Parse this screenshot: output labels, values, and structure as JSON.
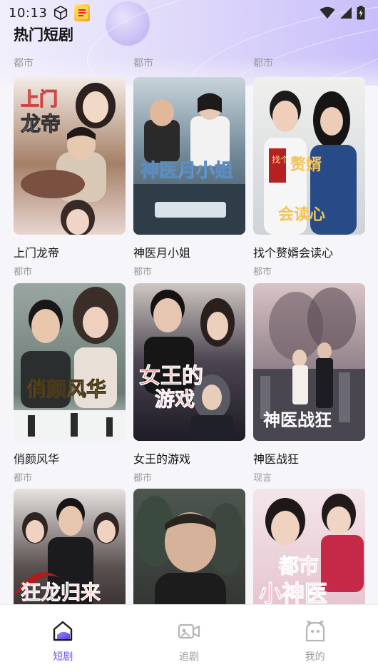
{
  "status": {
    "time": "10:13",
    "cube_icon": "cube-icon",
    "app_badge_text": "",
    "wifi_icon": "wifi-icon",
    "signal_icon": "signal-icon",
    "battery_icon": "battery-charging-icon"
  },
  "header": {
    "title": "热门短剧"
  },
  "previous_row_genres": [
    "都市",
    "都市",
    "都市"
  ],
  "dramas": [
    {
      "title": "上门龙帝",
      "genre": "都市",
      "poster_text": "上门龙帝",
      "accent": "#c7b08a"
    },
    {
      "title": "神医月小姐",
      "genre": "都市",
      "poster_text": "神医月小姐",
      "accent": "#6a8aa8"
    },
    {
      "title": "找个赘婿会读心",
      "genre": "都市",
      "poster_text": "找个赘婿会读心",
      "accent": "#3b5a8a"
    },
    {
      "title": "俏颜风华",
      "genre": "都市",
      "poster_text": "俏颜风华",
      "accent": "#a8b8a0"
    },
    {
      "title": "女王的游戏",
      "genre": "都市",
      "poster_text": "女王的游戏",
      "accent": "#3a2f4a"
    },
    {
      "title": "神医战狂",
      "genre": "现言",
      "poster_text": "神医战狂",
      "accent": "#8a6a7a"
    },
    {
      "title": "",
      "genre": "",
      "poster_text": "狂龙归来",
      "accent": "#2a2a2a"
    },
    {
      "title": "",
      "genre": "",
      "poster_text": "",
      "accent": "#4a4a48"
    },
    {
      "title": "",
      "genre": "",
      "poster_text": "都市小神医",
      "accent": "#c96a86"
    }
  ],
  "bottom_nav": [
    {
      "label": "短剧",
      "icon": "home-icon",
      "active": true
    },
    {
      "label": "追剧",
      "icon": "video-icon",
      "active": false
    },
    {
      "label": "我的",
      "icon": "profile-icon",
      "active": false
    }
  ],
  "colors": {
    "accent": "#6b4cf0",
    "inactive": "#9a9a9a",
    "title_text": "#141414"
  }
}
